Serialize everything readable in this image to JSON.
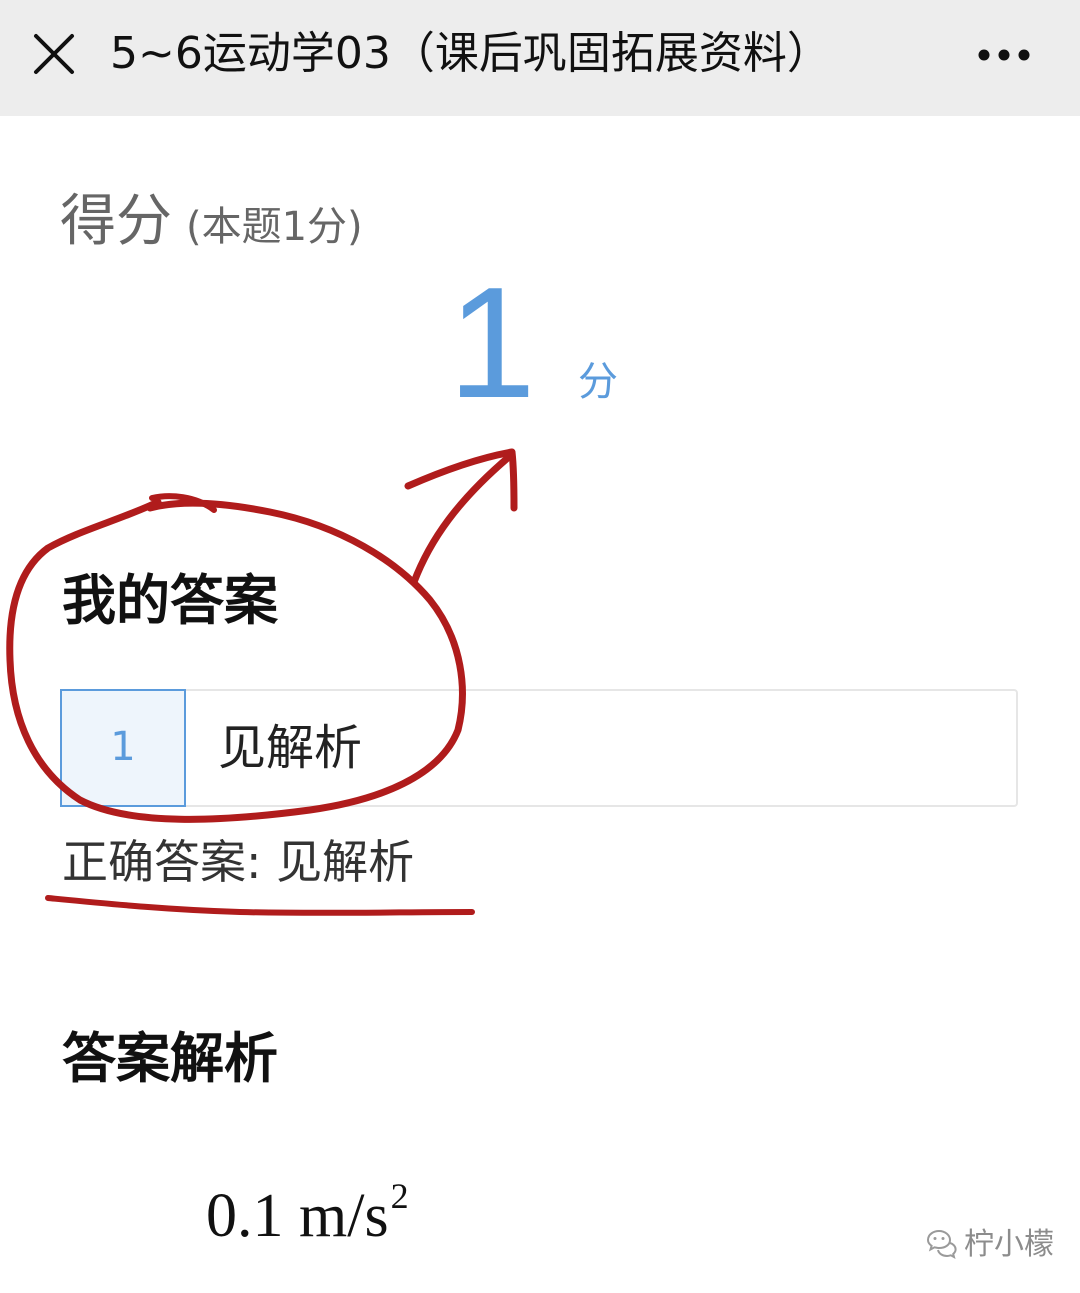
{
  "topbar": {
    "title": "5~6运动学03（课后巩固拓展资料）",
    "close_icon": "close-icon",
    "more_icon": "more-dots-icon",
    "background": "#ededed"
  },
  "score": {
    "label": "得分",
    "note": "(本题1分)",
    "value": "1",
    "unit": "分",
    "color": "#5b9bdc"
  },
  "my_answer": {
    "heading": "我的答案",
    "index": "1",
    "text": "见解析"
  },
  "correct_answer": {
    "label": "正确答案: 见解析"
  },
  "explanation": {
    "heading": "答案解析",
    "formula_main": "0.1 m/s",
    "formula_sup": "2"
  },
  "watermark": {
    "text": "柠小檬",
    "icon": "wechat-channel-icon"
  },
  "annotations": {
    "color": "#b01c1c",
    "marks": [
      "circle-around-my-answer",
      "arrow-to-score",
      "underline-correct-answer"
    ]
  }
}
